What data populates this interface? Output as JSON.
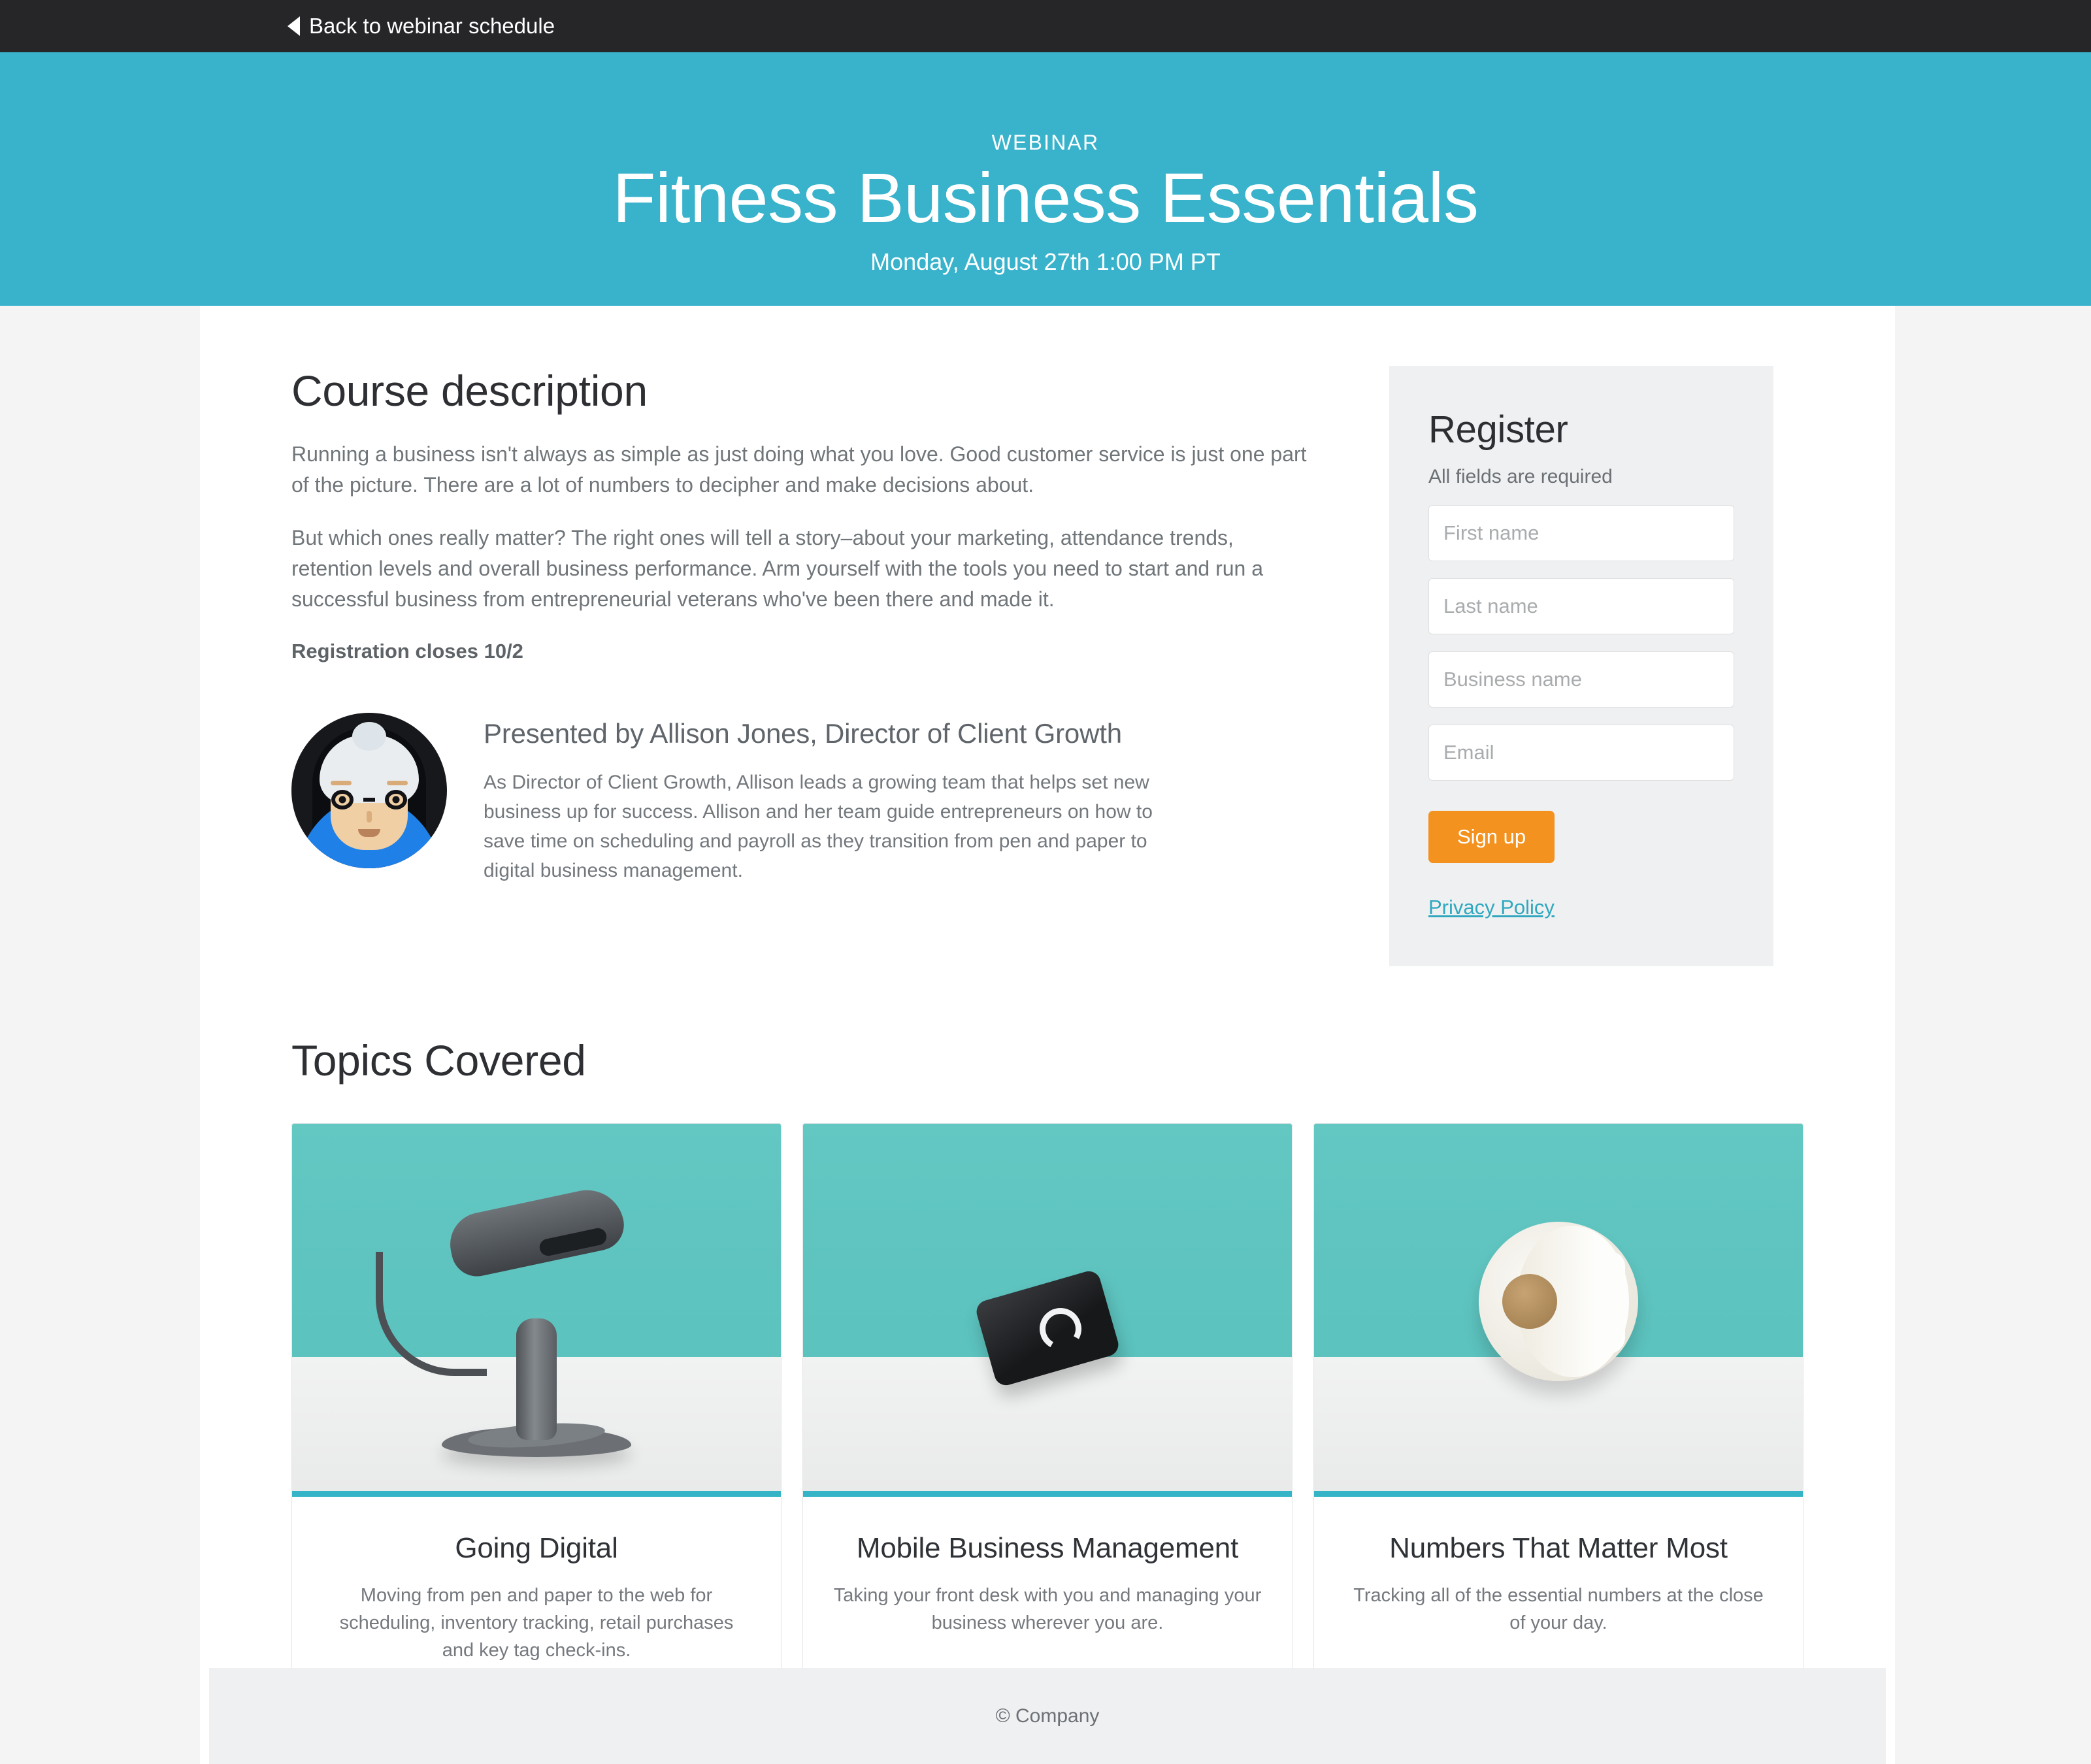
{
  "topbar": {
    "back_label": "Back to webinar schedule",
    "back_icon": "left-triangle-icon",
    "background": "#262629"
  },
  "hero": {
    "eyebrow": "WEBINAR",
    "title": "Fitness Business Essentials",
    "date": "Monday, August 27th 1:00 PM PT",
    "background": "#38b3cb"
  },
  "course": {
    "heading": "Course description",
    "paragraph1": "Running a business isn't always as simple as just doing what you love. Good customer service is just one part of the picture. There are a lot of numbers to decipher and make decisions about.",
    "paragraph2": "But which ones really matter? The right ones will tell a story–about your marketing, attendance trends, retention levels and overall business performance. Arm yourself with the tools you need to start and run a successful business from entrepreneurial veterans who've been there and made it.",
    "registration_note": "Registration closes 10/2"
  },
  "presenter": {
    "avatar_icon": "presenter-avatar-illustration",
    "name": "Presented by Allison Jones, Director of Client Growth",
    "bio": "As Director of Client Growth, Allison leads a growing team that helps set new business up for success. Allison and her team guide entrepreneurs on how to save time on scheduling and payroll as they transition from pen and paper to digital business management."
  },
  "register": {
    "title": "Register",
    "subtitle": "All fields are required",
    "fields": [
      {
        "name": "first-name",
        "placeholder": "First name",
        "value": ""
      },
      {
        "name": "last-name",
        "placeholder": "Last name",
        "value": ""
      },
      {
        "name": "business-name",
        "placeholder": "Business name",
        "value": ""
      },
      {
        "name": "email",
        "placeholder": "Email",
        "value": ""
      }
    ],
    "submit_label": "Sign up",
    "submit_color": "#f3921e",
    "privacy_label": "Privacy Policy",
    "link_color": "#2fa8bf",
    "panel_background": "#eef0f1"
  },
  "topics": {
    "heading": "Topics Covered",
    "accent_color": "#35b3c7",
    "cards": [
      {
        "image_icon": "barcode-scanner-photo",
        "title": "Going Digital",
        "description": "Moving from pen and paper to the web for scheduling, inventory tracking, retail purchases and key tag check-ins."
      },
      {
        "image_icon": "card-reader-photo",
        "title": "Mobile Business Management",
        "description": "Taking your front desk with you and managing your business wherever you are."
      },
      {
        "image_icon": "label-roll-photo",
        "title": "Numbers That Matter Most",
        "description": "Tracking all of the essential numbers at the close of your day."
      }
    ]
  },
  "footer": {
    "copyright": "© Company"
  }
}
